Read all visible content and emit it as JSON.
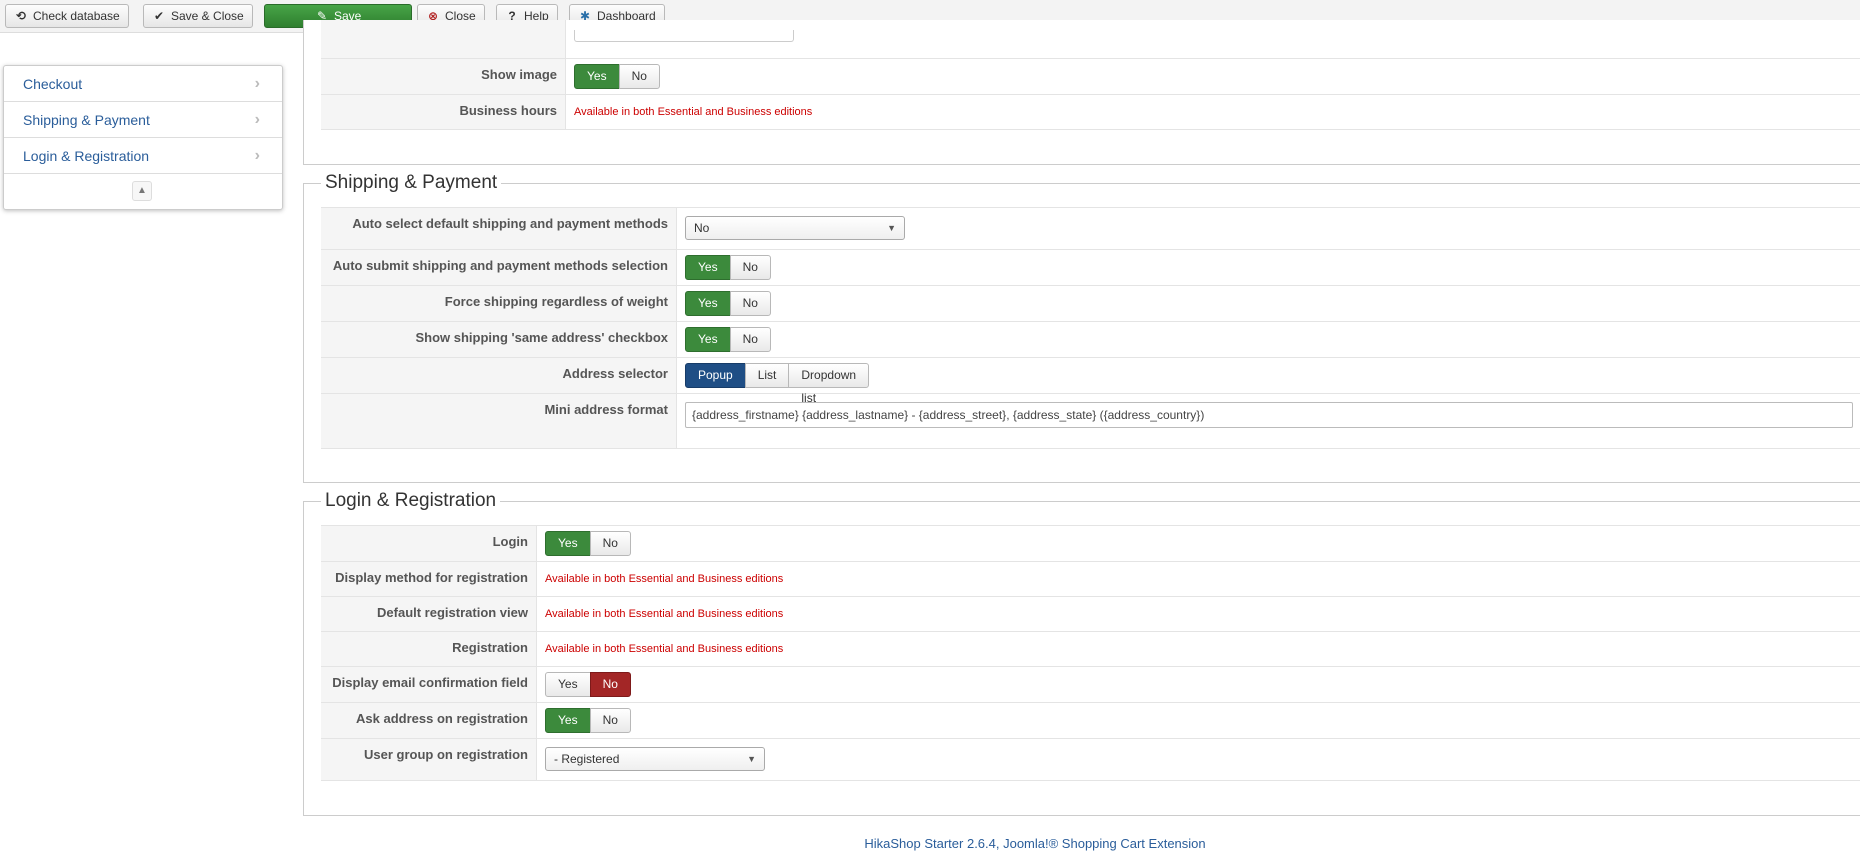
{
  "toolbar": {
    "check_database": "Check database",
    "save_close": "Save & Close",
    "save": "Save",
    "close": "Close",
    "help": "Help",
    "dashboard": "Dashboard",
    "colors": {
      "save_bg": "#3c8a3c"
    }
  },
  "sidenav": {
    "items": [
      {
        "label": "Checkout"
      },
      {
        "label": "Shipping & Payment"
      },
      {
        "label": "Login & Registration"
      }
    ]
  },
  "checkout": {
    "show_image": {
      "label": "Show image",
      "options": [
        "Yes",
        "No"
      ],
      "selected": "Yes"
    },
    "business_hours": {
      "label": "Business hours",
      "note": "Available in both Essential and Business editions"
    }
  },
  "shipping_payment": {
    "title": "Shipping & Payment",
    "auto_select": {
      "label": "Auto select default shipping and payment methods",
      "value": "No"
    },
    "auto_submit": {
      "label": "Auto submit shipping and payment methods selection",
      "options": [
        "Yes",
        "No"
      ],
      "selected": "Yes"
    },
    "force_shipping": {
      "label": "Force shipping regardless of weight",
      "options": [
        "Yes",
        "No"
      ],
      "selected": "Yes"
    },
    "same_address": {
      "label": "Show shipping 'same address' checkbox",
      "options": [
        "Yes",
        "No"
      ],
      "selected": "Yes"
    },
    "address_selector": {
      "label": "Address selector",
      "options": [
        "Popup",
        "List",
        "Dropdown list"
      ],
      "selected": "Popup"
    },
    "mini_address": {
      "label": "Mini address format",
      "value": "{address_firstname} {address_lastname} - {address_street}, {address_state} ({address_country})"
    }
  },
  "login_registration": {
    "title": "Login & Registration",
    "login": {
      "label": "Login",
      "options": [
        "Yes",
        "No"
      ],
      "selected": "Yes"
    },
    "display_method": {
      "label": "Display method for registration",
      "note": "Available in both Essential and Business editions"
    },
    "default_view": {
      "label": "Default registration view",
      "note": "Available in both Essential and Business editions"
    },
    "registration": {
      "label": "Registration",
      "note": "Available in both Essential and Business editions"
    },
    "email_confirm": {
      "label": "Display email confirmation field",
      "options": [
        "Yes",
        "No"
      ],
      "selected": "No"
    },
    "ask_address": {
      "label": "Ask address on registration",
      "options": [
        "Yes",
        "No"
      ],
      "selected": "Yes"
    },
    "user_group": {
      "label": "User group on registration",
      "value": "- Registered"
    }
  },
  "footer": {
    "text": "HikaShop Starter 2.6.4, Joomla!® Shopping Cart Extension"
  }
}
